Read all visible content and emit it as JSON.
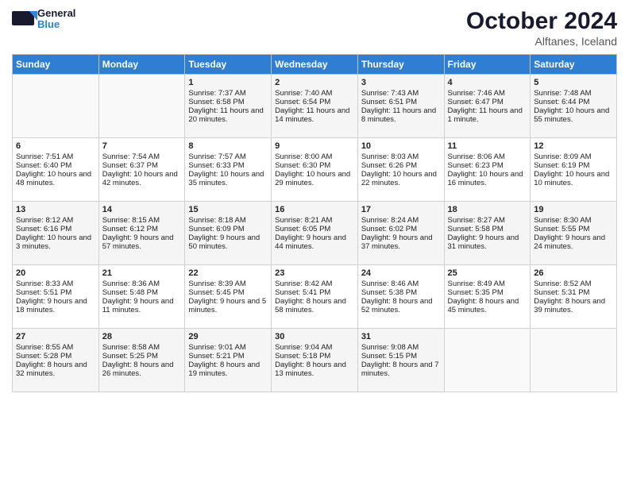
{
  "header": {
    "logo": "GeneralBlue",
    "title": "October 2024",
    "location": "Alftanes, Iceland"
  },
  "weekdays": [
    "Sunday",
    "Monday",
    "Tuesday",
    "Wednesday",
    "Thursday",
    "Friday",
    "Saturday"
  ],
  "weeks": [
    [
      {
        "day": "",
        "empty": true
      },
      {
        "day": "",
        "empty": true
      },
      {
        "day": "1",
        "sunrise": "Sunrise: 7:37 AM",
        "sunset": "Sunset: 6:58 PM",
        "daylight": "Daylight: 11 hours and 20 minutes."
      },
      {
        "day": "2",
        "sunrise": "Sunrise: 7:40 AM",
        "sunset": "Sunset: 6:54 PM",
        "daylight": "Daylight: 11 hours and 14 minutes."
      },
      {
        "day": "3",
        "sunrise": "Sunrise: 7:43 AM",
        "sunset": "Sunset: 6:51 PM",
        "daylight": "Daylight: 11 hours and 8 minutes."
      },
      {
        "day": "4",
        "sunrise": "Sunrise: 7:46 AM",
        "sunset": "Sunset: 6:47 PM",
        "daylight": "Daylight: 11 hours and 1 minute."
      },
      {
        "day": "5",
        "sunrise": "Sunrise: 7:48 AM",
        "sunset": "Sunset: 6:44 PM",
        "daylight": "Daylight: 10 hours and 55 minutes."
      }
    ],
    [
      {
        "day": "6",
        "sunrise": "Sunrise: 7:51 AM",
        "sunset": "Sunset: 6:40 PM",
        "daylight": "Daylight: 10 hours and 48 minutes."
      },
      {
        "day": "7",
        "sunrise": "Sunrise: 7:54 AM",
        "sunset": "Sunset: 6:37 PM",
        "daylight": "Daylight: 10 hours and 42 minutes."
      },
      {
        "day": "8",
        "sunrise": "Sunrise: 7:57 AM",
        "sunset": "Sunset: 6:33 PM",
        "daylight": "Daylight: 10 hours and 35 minutes."
      },
      {
        "day": "9",
        "sunrise": "Sunrise: 8:00 AM",
        "sunset": "Sunset: 6:30 PM",
        "daylight": "Daylight: 10 hours and 29 minutes."
      },
      {
        "day": "10",
        "sunrise": "Sunrise: 8:03 AM",
        "sunset": "Sunset: 6:26 PM",
        "daylight": "Daylight: 10 hours and 22 minutes."
      },
      {
        "day": "11",
        "sunrise": "Sunrise: 8:06 AM",
        "sunset": "Sunset: 6:23 PM",
        "daylight": "Daylight: 10 hours and 16 minutes."
      },
      {
        "day": "12",
        "sunrise": "Sunrise: 8:09 AM",
        "sunset": "Sunset: 6:19 PM",
        "daylight": "Daylight: 10 hours and 10 minutes."
      }
    ],
    [
      {
        "day": "13",
        "sunrise": "Sunrise: 8:12 AM",
        "sunset": "Sunset: 6:16 PM",
        "daylight": "Daylight: 10 hours and 3 minutes."
      },
      {
        "day": "14",
        "sunrise": "Sunrise: 8:15 AM",
        "sunset": "Sunset: 6:12 PM",
        "daylight": "Daylight: 9 hours and 57 minutes."
      },
      {
        "day": "15",
        "sunrise": "Sunrise: 8:18 AM",
        "sunset": "Sunset: 6:09 PM",
        "daylight": "Daylight: 9 hours and 50 minutes."
      },
      {
        "day": "16",
        "sunrise": "Sunrise: 8:21 AM",
        "sunset": "Sunset: 6:05 PM",
        "daylight": "Daylight: 9 hours and 44 minutes."
      },
      {
        "day": "17",
        "sunrise": "Sunrise: 8:24 AM",
        "sunset": "Sunset: 6:02 PM",
        "daylight": "Daylight: 9 hours and 37 minutes."
      },
      {
        "day": "18",
        "sunrise": "Sunrise: 8:27 AM",
        "sunset": "Sunset: 5:58 PM",
        "daylight": "Daylight: 9 hours and 31 minutes."
      },
      {
        "day": "19",
        "sunrise": "Sunrise: 8:30 AM",
        "sunset": "Sunset: 5:55 PM",
        "daylight": "Daylight: 9 hours and 24 minutes."
      }
    ],
    [
      {
        "day": "20",
        "sunrise": "Sunrise: 8:33 AM",
        "sunset": "Sunset: 5:51 PM",
        "daylight": "Daylight: 9 hours and 18 minutes."
      },
      {
        "day": "21",
        "sunrise": "Sunrise: 8:36 AM",
        "sunset": "Sunset: 5:48 PM",
        "daylight": "Daylight: 9 hours and 11 minutes."
      },
      {
        "day": "22",
        "sunrise": "Sunrise: 8:39 AM",
        "sunset": "Sunset: 5:45 PM",
        "daylight": "Daylight: 9 hours and 5 minutes."
      },
      {
        "day": "23",
        "sunrise": "Sunrise: 8:42 AM",
        "sunset": "Sunset: 5:41 PM",
        "daylight": "Daylight: 8 hours and 58 minutes."
      },
      {
        "day": "24",
        "sunrise": "Sunrise: 8:46 AM",
        "sunset": "Sunset: 5:38 PM",
        "daylight": "Daylight: 8 hours and 52 minutes."
      },
      {
        "day": "25",
        "sunrise": "Sunrise: 8:49 AM",
        "sunset": "Sunset: 5:35 PM",
        "daylight": "Daylight: 8 hours and 45 minutes."
      },
      {
        "day": "26",
        "sunrise": "Sunrise: 8:52 AM",
        "sunset": "Sunset: 5:31 PM",
        "daylight": "Daylight: 8 hours and 39 minutes."
      }
    ],
    [
      {
        "day": "27",
        "sunrise": "Sunrise: 8:55 AM",
        "sunset": "Sunset: 5:28 PM",
        "daylight": "Daylight: 8 hours and 32 minutes."
      },
      {
        "day": "28",
        "sunrise": "Sunrise: 8:58 AM",
        "sunset": "Sunset: 5:25 PM",
        "daylight": "Daylight: 8 hours and 26 minutes."
      },
      {
        "day": "29",
        "sunrise": "Sunrise: 9:01 AM",
        "sunset": "Sunset: 5:21 PM",
        "daylight": "Daylight: 8 hours and 19 minutes."
      },
      {
        "day": "30",
        "sunrise": "Sunrise: 9:04 AM",
        "sunset": "Sunset: 5:18 PM",
        "daylight": "Daylight: 8 hours and 13 minutes."
      },
      {
        "day": "31",
        "sunrise": "Sunrise: 9:08 AM",
        "sunset": "Sunset: 5:15 PM",
        "daylight": "Daylight: 8 hours and 7 minutes."
      },
      {
        "day": "",
        "empty": true
      },
      {
        "day": "",
        "empty": true
      }
    ]
  ]
}
